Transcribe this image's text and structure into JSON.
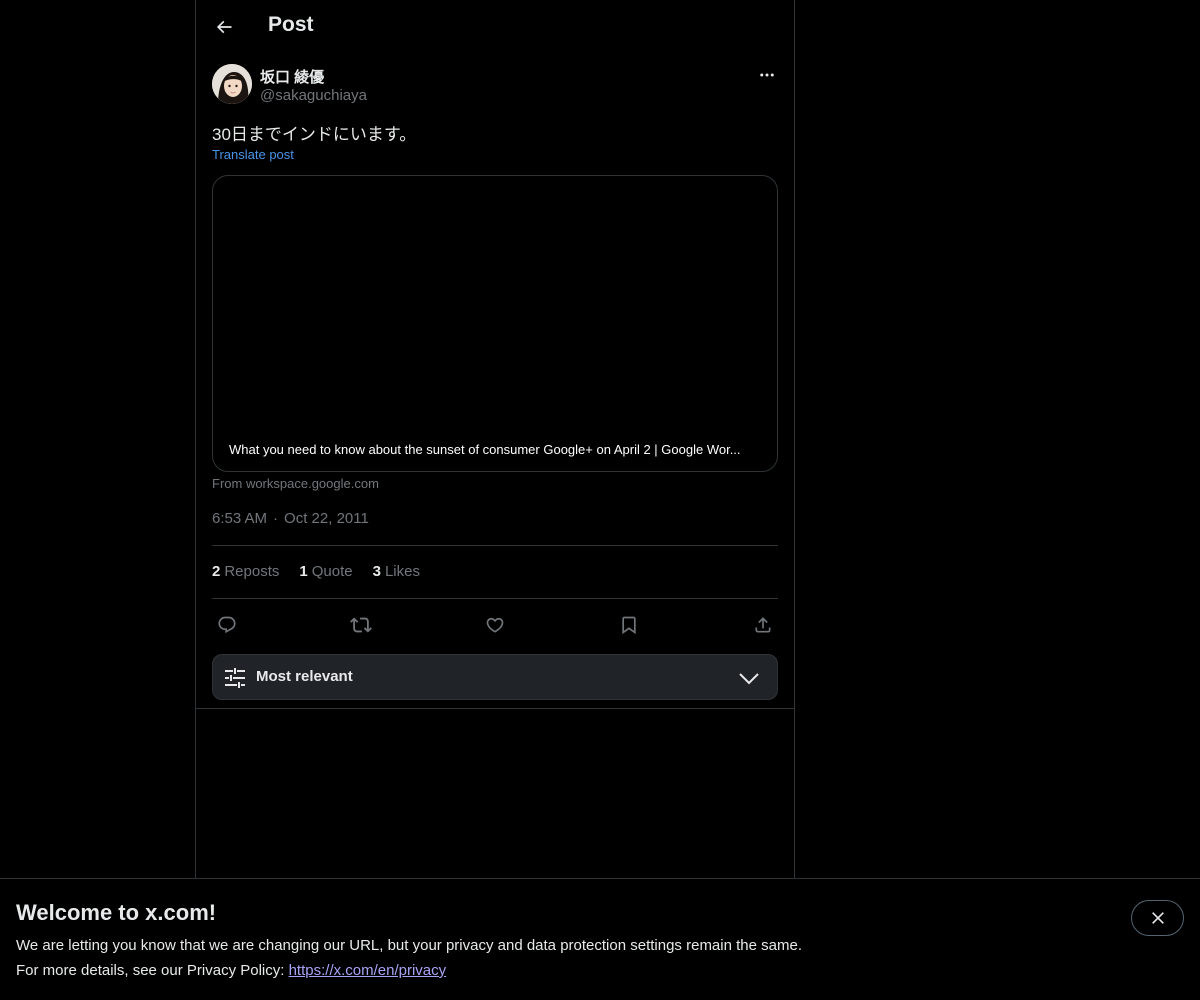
{
  "header": {
    "title": "Post",
    "back_icon": "arrow-left-icon"
  },
  "post": {
    "author": {
      "display_name": "坂口 綾優",
      "handle": "@sakaguchiaya"
    },
    "text": "30日までインドにいます。",
    "translate_label": "Translate post",
    "link_card": {
      "title": "What you need to know about the sunset of consumer Google+ on April 2 | Google Wor...",
      "source": "From workspace.google.com"
    },
    "time": "6:53 AM",
    "date": "Oct 22, 2011",
    "separator": "·",
    "stats": {
      "reposts_count": "2",
      "reposts_label": "Reposts",
      "quotes_count": "1",
      "quotes_label": "Quote",
      "likes_count": "3",
      "likes_label": "Likes"
    }
  },
  "replies_sort": {
    "label": "Most relevant"
  },
  "banner": {
    "title": "Welcome to x.com!",
    "line1": "We are letting you know that we are changing our URL, but your privacy and data protection settings remain the same.",
    "line2_prefix": "For more details, see our Privacy Policy: ",
    "privacy_link": "https://x.com/en/privacy"
  },
  "colors": {
    "background": "#000000",
    "text_primary": "#e7e9ea",
    "text_secondary": "#71767b",
    "link_blue": "#4a94e6",
    "border": "#2f3336",
    "privacy_link": "#a7a3f5"
  }
}
